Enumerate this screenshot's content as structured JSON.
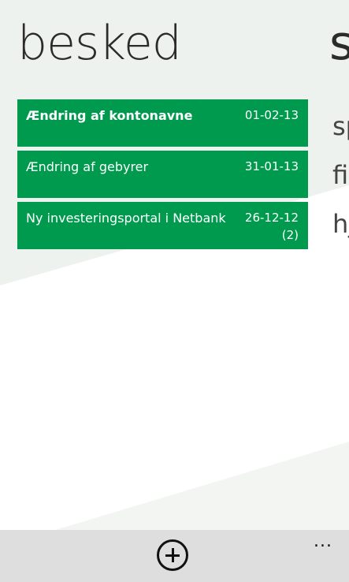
{
  "page": {
    "title": "besked",
    "next_title": "s",
    "next_items": [
      "sp",
      "fi",
      "hj"
    ]
  },
  "messages": [
    {
      "subject": "Ændring af kontonavne",
      "date": "01-02-13",
      "count": "",
      "unread": true
    },
    {
      "subject": "Ændring af gebyrer",
      "date": "31-01-13",
      "count": "",
      "unread": false
    },
    {
      "subject": "Ny investeringsportal i Netbank",
      "date": "26-12-12",
      "count": "(2)",
      "unread": false
    }
  ],
  "app_bar": {
    "add_icon": "plus-circle-icon",
    "more_label": "..."
  },
  "colors": {
    "accent": "#009a4e",
    "app_bar": "#dedede",
    "background_tint": "#eef2ef"
  }
}
